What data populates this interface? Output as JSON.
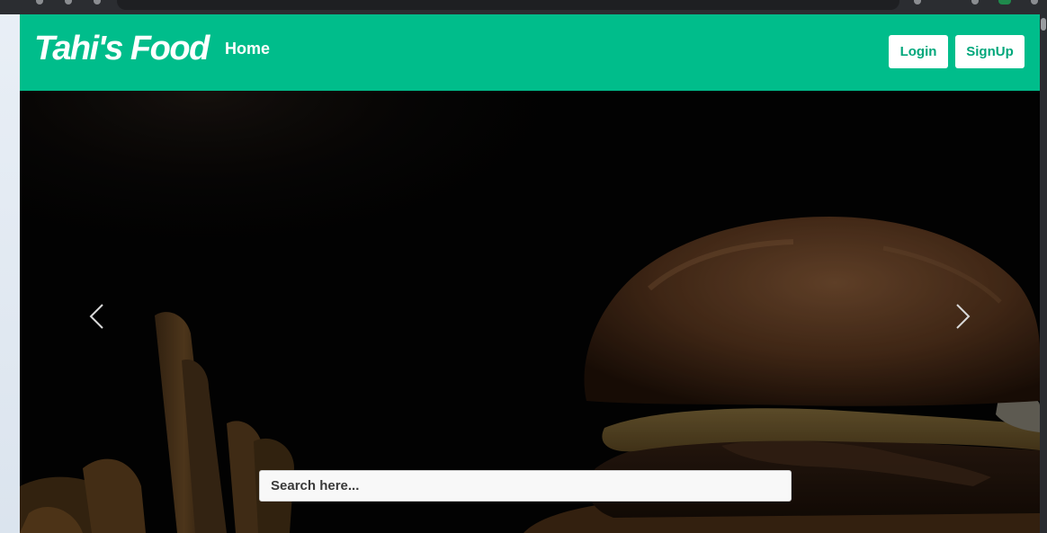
{
  "navbar": {
    "brand": "Tahi's Food",
    "home_link": "Home",
    "login_label": "Login",
    "signup_label": "SignUp",
    "bg_color": "#00bd8b"
  },
  "hero": {
    "prev_icon": "chevron-left-icon",
    "next_icon": "chevron-right-icon",
    "search_placeholder": "Search here...",
    "search_value": ""
  },
  "colors": {
    "accent": "#00bd8b",
    "button_text": "#00a77b"
  }
}
